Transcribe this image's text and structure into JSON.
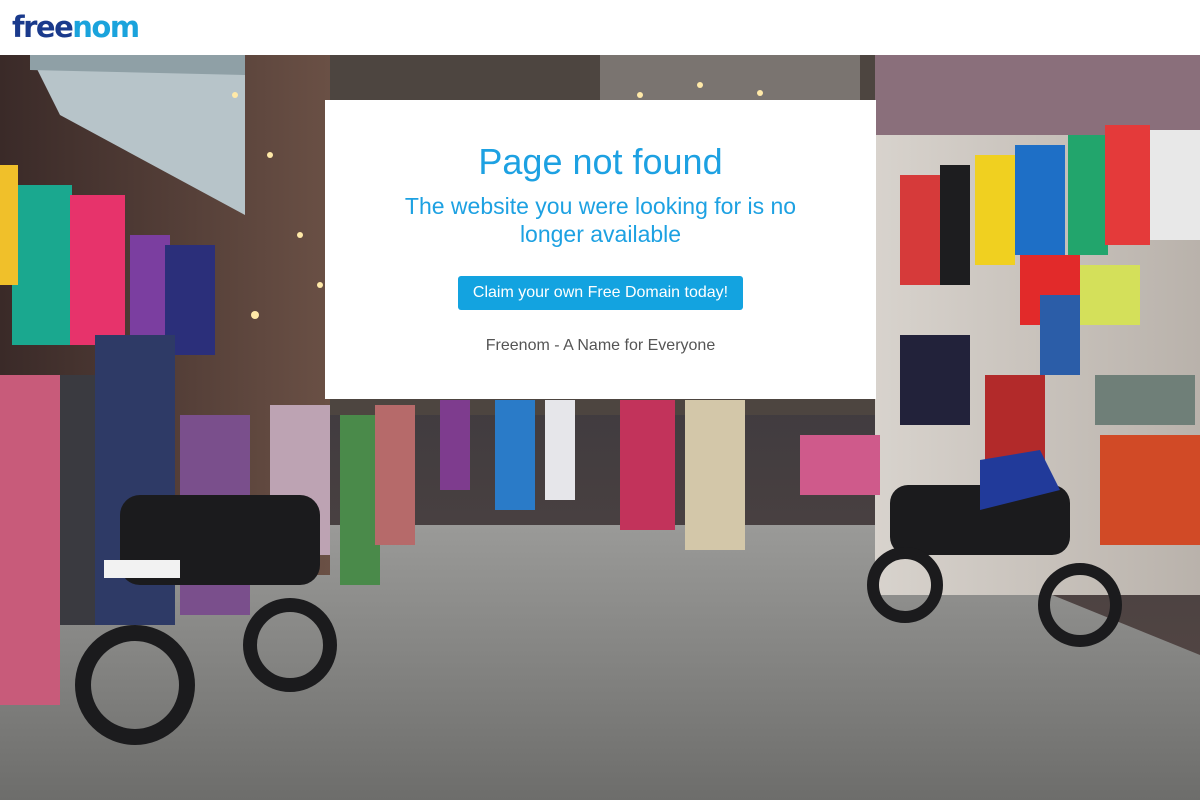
{
  "header": {
    "logo_text_part1": "free",
    "logo_text_part2": "nom"
  },
  "error_card": {
    "title": "Page not found",
    "subtitle": "The website you were looking for is no longer available",
    "cta_label": "Claim your own Free Domain today!",
    "tagline": "Freenom - A Name for Everyone"
  },
  "colors": {
    "brand_dark": "#1a3a8c",
    "brand_light": "#1aa3dc",
    "accent": "#13a3e0",
    "tagline_text": "#555555"
  },
  "background": {
    "scene": "market-street-photo"
  }
}
